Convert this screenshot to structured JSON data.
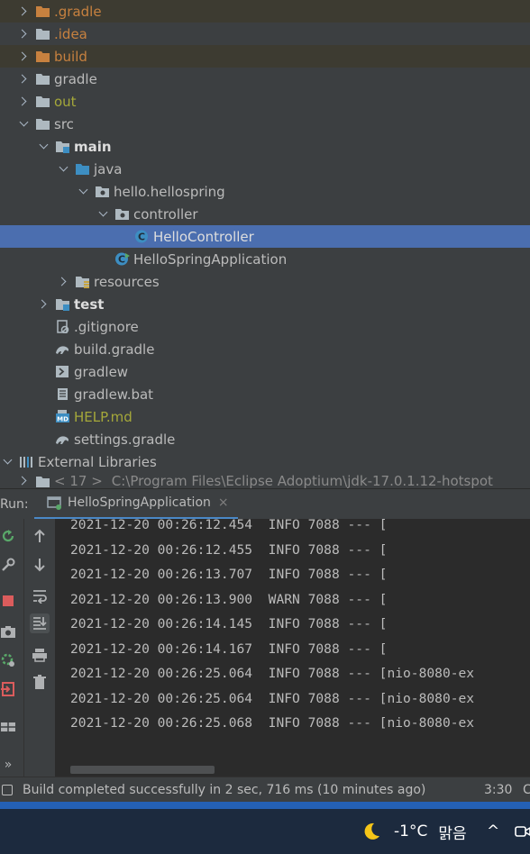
{
  "project_tree": {
    "rows": [
      {
        "label": ".gradle",
        "state": "excluded"
      },
      {
        "label": ".idea",
        "state": "normal"
      },
      {
        "label": "build",
        "state": "excluded"
      },
      {
        "label": "gradle",
        "state": "normal"
      },
      {
        "label": "out",
        "state": "normal"
      },
      {
        "label": "src",
        "state": "expanded"
      },
      {
        "label": "main",
        "state": "expanded"
      },
      {
        "label": "java",
        "state": "expanded"
      },
      {
        "label": "hello.hellospring",
        "state": "expanded"
      },
      {
        "label": "controller",
        "state": "expanded"
      },
      {
        "label": "HelloController",
        "state": "selected"
      },
      {
        "label": "HelloSpringApplication",
        "state": "normal"
      },
      {
        "label": "resources",
        "state": "collapsed"
      },
      {
        "label": "test",
        "state": "collapsed"
      },
      {
        "label": ".gitignore",
        "state": "file"
      },
      {
        "label": "build.gradle",
        "state": "file"
      },
      {
        "label": "gradlew",
        "state": "file"
      },
      {
        "label": "gradlew.bat",
        "state": "file"
      },
      {
        "label": "HELP.md",
        "state": "file"
      },
      {
        "label": "settings.gradle",
        "state": "file"
      },
      {
        "label": "External Libraries",
        "state": "expanded"
      },
      {
        "label": "< 17 >",
        "state": "collapsed"
      }
    ],
    "partial_path": "C:\\Program Files\\Eclipse Adoptium\\jdk-17.0.1.12-hotspot"
  },
  "run_panel": {
    "label": "Run:",
    "tab_title": "HelloSpringApplication",
    "close_glyph": "×",
    "toolbar_left": [
      "rerun-icon",
      "wrench-icon",
      "stop-icon",
      "camera-icon",
      "settings-icon",
      "exit-icon",
      "layout-icon",
      "more-icon"
    ],
    "toolbar_right": [
      "up-arrow-icon",
      "down-arrow-icon",
      "soft-wrap-icon",
      "scroll-to-end-icon",
      "print-icon",
      "trash-icon"
    ],
    "more_glyph": "»",
    "log_lines": [
      "2021-12-20 00:26:12.454  INFO 7088 --- [",
      "2021-12-20 00:26:12.455  INFO 7088 --- [",
      "2021-12-20 00:26:13.707  INFO 7088 --- [",
      "2021-12-20 00:26:13.900  WARN 7088 --- [",
      "2021-12-20 00:26:14.145  INFO 7088 --- [",
      "2021-12-20 00:26:14.167  INFO 7088 --- [",
      "2021-12-20 00:26:25.064  INFO 7088 --- [nio-8080-ex",
      "2021-12-20 00:26:25.064  INFO 7088 --- [nio-8080-ex",
      "2021-12-20 00:26:25.068  INFO 7088 --- [nio-8080-ex"
    ]
  },
  "status_bar": {
    "message": "Build completed successfully in 2 sec, 716 ms (10 minutes ago)",
    "position": "3:30",
    "extra": "C"
  },
  "taskbar": {
    "weather_icon": "moon-icon",
    "temperature": "-1°C",
    "condition": "맑음",
    "chevron": "^",
    "accent": "#2460b5"
  },
  "colors": {
    "selection": "#4b6eaf",
    "excluded_row": "#3d3b31",
    "folder": "#aeb9c0",
    "excluded_folder": "#c7813f",
    "source_folder": "#3d8ec2"
  }
}
